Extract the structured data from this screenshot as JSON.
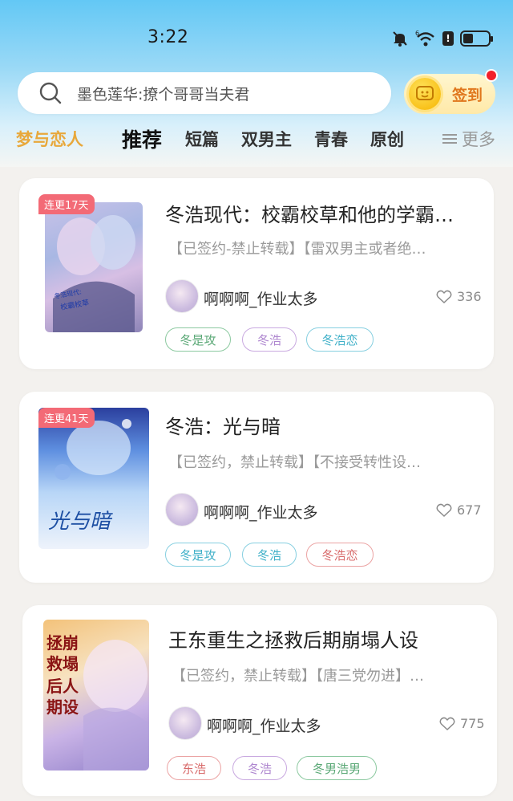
{
  "status_bar": {
    "time": "3:22",
    "network": "6"
  },
  "search": {
    "placeholder": "墨色莲华:撩个哥哥当夫君"
  },
  "signin": {
    "label": "签到"
  },
  "tabs": {
    "brand": "梦与恋人",
    "items": [
      "推荐",
      "短篇",
      "双男主",
      "青春",
      "原创"
    ],
    "more": "更多"
  },
  "books": [
    {
      "badge": "连更17天",
      "title": "冬浩现代：校霸校草和他的学霸…",
      "desc": "【已签约-禁止转载】【雷双男主或者绝…",
      "author": "啊啊啊_作业太多",
      "likes": "336",
      "tags": [
        "冬是攻",
        "冬浩",
        "冬浩恋"
      ]
    },
    {
      "badge": "连更41天",
      "title": "冬浩：光与暗",
      "desc": "【已签约，禁止转载】【不接受转性设…",
      "author": "啊啊啊_作业太多",
      "likes": "677",
      "tags": [
        "冬是攻",
        "冬浩",
        "冬浩恋"
      ],
      "cover_text": "光与暗"
    },
    {
      "badge": "",
      "title": "王东重生之拯救后期崩塌人设",
      "desc": "【已签约，禁止转载】【唐三党勿进】…",
      "author": "啊啊啊_作业太多",
      "likes": "775",
      "tags": [
        "东浩",
        "冬浩",
        "冬男浩男"
      ],
      "cover_text": "拯救崩塌后期人设"
    }
  ],
  "colors": {
    "brand": "#e8a83b",
    "badge": "#f36a76",
    "notify": "#f2202b"
  }
}
